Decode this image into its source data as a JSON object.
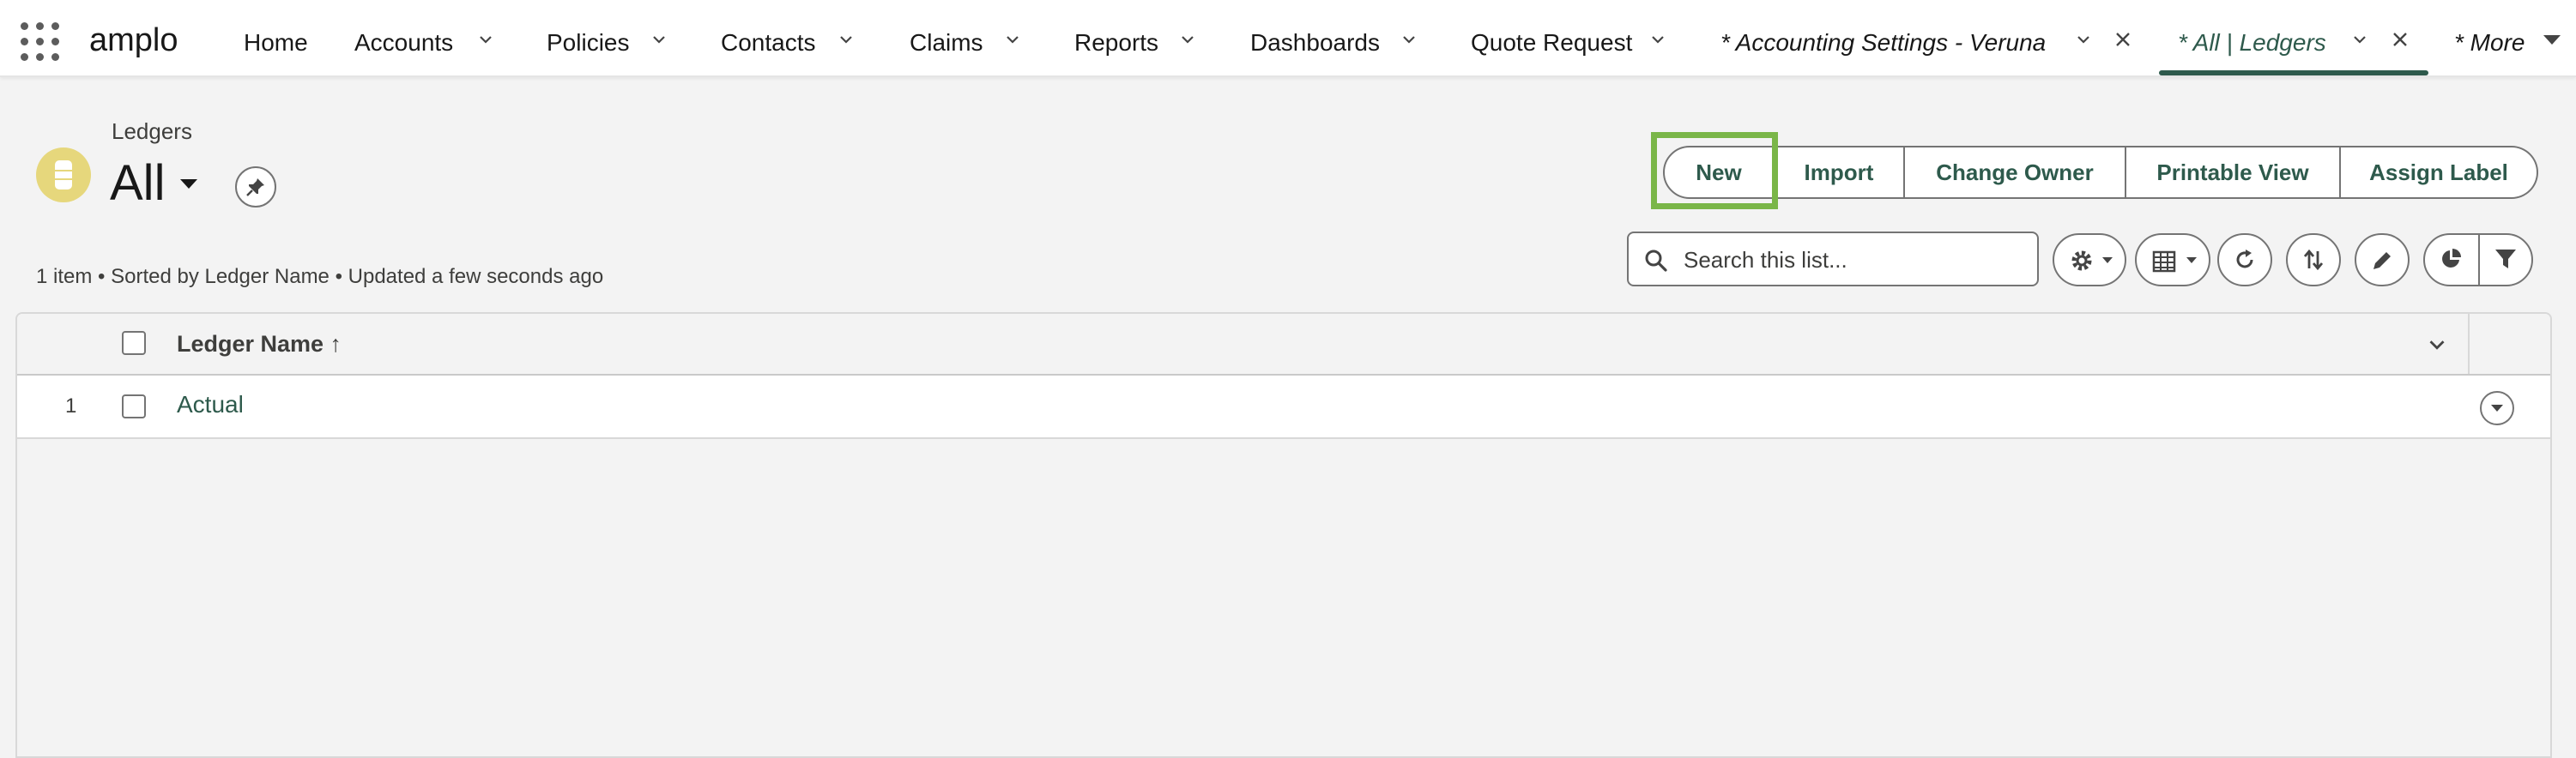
{
  "app": {
    "name": "amplo"
  },
  "nav": {
    "items": [
      {
        "label": "Home"
      },
      {
        "label": "Accounts"
      },
      {
        "label": "Policies"
      },
      {
        "label": "Contacts"
      },
      {
        "label": "Claims"
      },
      {
        "label": "Reports"
      },
      {
        "label": "Dashboards"
      },
      {
        "label": "Quote Request"
      }
    ],
    "tabs": [
      {
        "label": "* Accounting Settings - Veruna"
      },
      {
        "label": "* All | Ledgers",
        "active": true
      }
    ],
    "more_label": "* More"
  },
  "header": {
    "breadcrumb": "Ledgers",
    "title": "All",
    "icon": "ledger-icon",
    "icon_color": "#e6d77c"
  },
  "actions": [
    {
      "label": "New",
      "highlighted": true
    },
    {
      "label": "Import"
    },
    {
      "label": "Change Owner"
    },
    {
      "label": "Printable View"
    },
    {
      "label": "Assign Label"
    }
  ],
  "status": "1 item • Sorted by Ledger Name • Updated a few seconds ago",
  "search": {
    "placeholder": "Search this list...",
    "value": ""
  },
  "table": {
    "columns": [
      {
        "label": "Ledger Name ↑"
      }
    ],
    "rows": [
      {
        "num": "1",
        "name": "Actual"
      }
    ]
  },
  "colors": {
    "accent": "#2e5a4c",
    "highlight": "#7ab648"
  }
}
